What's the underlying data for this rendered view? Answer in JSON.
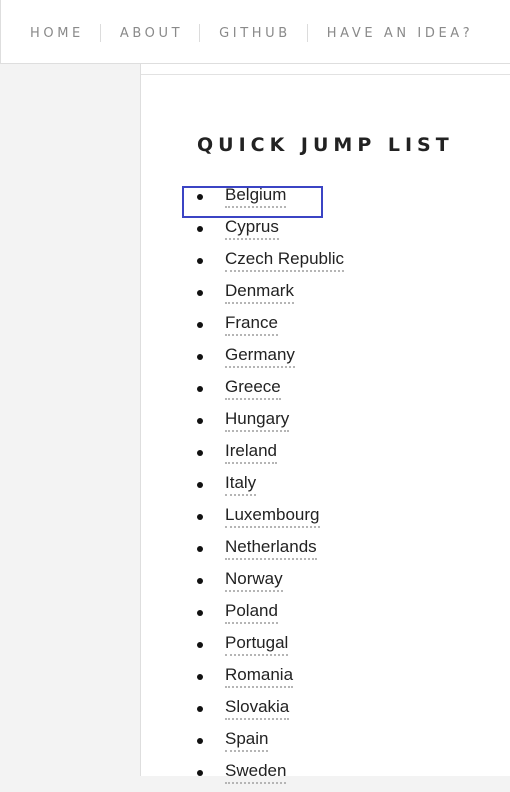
{
  "nav": {
    "items": [
      {
        "label": "HOME"
      },
      {
        "label": "ABOUT"
      },
      {
        "label": "GITHUB"
      },
      {
        "label": "HAVE AN IDEA?"
      }
    ]
  },
  "main": {
    "title": "QUICK JUMP LIST",
    "highlighted_item": "Belgium",
    "highlight_color": "#3b44c4",
    "countries": [
      "Belgium",
      "Cyprus",
      "Czech Republic",
      "Denmark",
      "France",
      "Germany",
      "Greece",
      "Hungary",
      "Ireland",
      "Italy",
      "Luxembourg",
      "Netherlands",
      "Norway",
      "Poland",
      "Portugal",
      "Romania",
      "Slovakia",
      "Spain",
      "Sweden"
    ]
  }
}
